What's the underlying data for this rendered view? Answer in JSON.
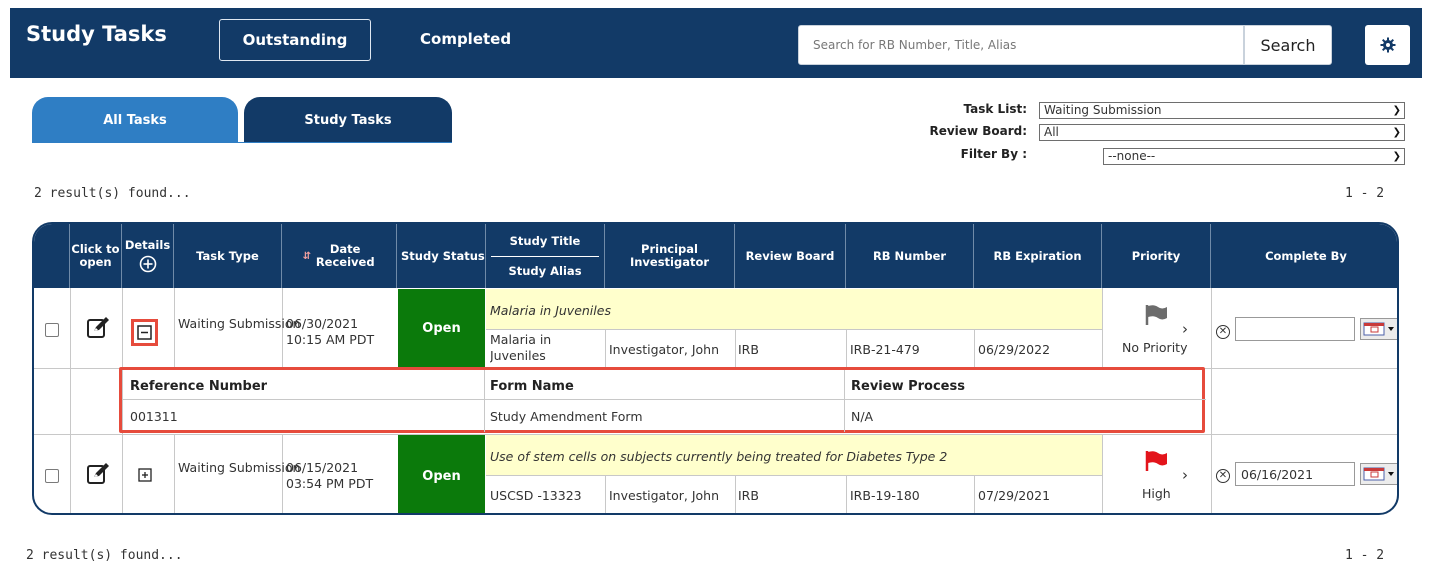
{
  "header": {
    "title": "Study Tasks",
    "tabs": [
      "Outstanding",
      "Completed"
    ],
    "search_placeholder": "Search for RB Number, Title, Alias",
    "search_button": "Search"
  },
  "sub_tabs": [
    "All Tasks",
    "Study Tasks"
  ],
  "filters": {
    "task_list_label": "Task List:",
    "task_list_value": "Waiting Submission",
    "review_board_label": "Review Board:",
    "review_board_value": "All",
    "filter_by_label": "Filter By :",
    "filter_by_value": "--none--"
  },
  "results": {
    "found_text": "2 result(s) found...",
    "range": "1 - 2"
  },
  "table": {
    "headers": {
      "click_to_open": "Click to open",
      "details": "Details",
      "task_type": "Task Type",
      "date_received": "Date Received",
      "study_status": "Study Status",
      "study_title": "Study Title",
      "study_alias": "Study Alias",
      "principal_investigator": "Principal Investigator",
      "review_board": "Review Board",
      "rb_number": "RB Number",
      "rb_expiration": "RB Expiration",
      "priority": "Priority",
      "complete_by": "Complete By"
    },
    "rows": [
      {
        "task_type": "Waiting Submission",
        "date": "06/30/2021",
        "time": "10:15 AM PDT",
        "status": "Open",
        "title": "Malaria in Juveniles",
        "alias": "Malaria in Juveniles",
        "investigator": "Investigator, John",
        "review_board": "IRB",
        "rb_number": "IRB-21-479",
        "rb_expiration": "06/29/2022",
        "priority": "No Priority",
        "complete_by": ""
      },
      {
        "task_type": "Waiting Submission",
        "date": "06/15/2021",
        "time": "03:54 PM PDT",
        "status": "Open",
        "title": "Use of stem cells on subjects currently being treated for Diabetes Type 2",
        "alias": "USCSD -13323",
        "investigator": "Investigator, John",
        "review_board": "IRB",
        "rb_number": "IRB-19-180",
        "rb_expiration": "07/29/2021",
        "priority": "High",
        "complete_by": "06/16/2021"
      }
    ],
    "details": {
      "headers": [
        "Reference Number",
        "Form Name",
        "Review Process"
      ],
      "values": [
        "001311",
        "Study Amendment Form",
        "N/A"
      ]
    }
  },
  "colors": {
    "navy": "#123a67",
    "tab_blue": "#2f7ec4",
    "open_green": "#0b7a0b",
    "highlight_red": "#e64b3c",
    "title_yellow": "#ffffcc"
  }
}
